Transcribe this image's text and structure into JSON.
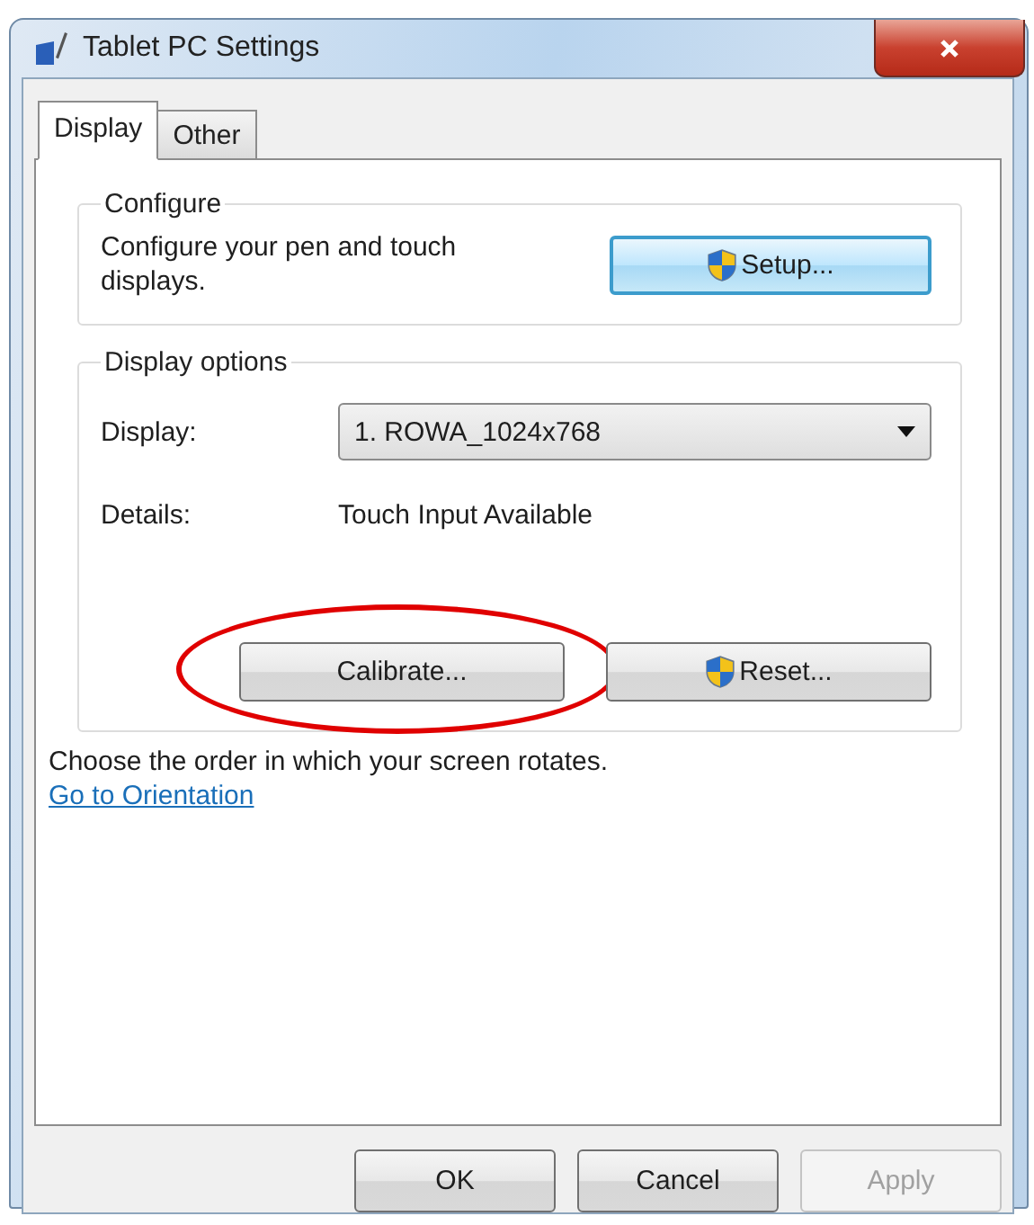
{
  "window": {
    "title": "Tablet PC Settings"
  },
  "tabs": [
    {
      "label": "Display",
      "selected": true
    },
    {
      "label": "Other",
      "selected": false
    }
  ],
  "configure": {
    "legend": "Configure",
    "text": "Configure your pen and touch displays.",
    "button": {
      "label": "Setup...",
      "shield": true,
      "default": true
    }
  },
  "display_options": {
    "legend": "Display options",
    "display_label": "Display:",
    "display_value": "1. ROWA_1024x768",
    "details_label": "Details:",
    "details_value": "Touch Input Available",
    "buttons": [
      {
        "label": "Calibrate...",
        "shield": false,
        "highlighted": true
      },
      {
        "label": "Reset...",
        "shield": true,
        "highlighted": false
      }
    ]
  },
  "orientation": {
    "text": "Choose the order in which your screen rotates.",
    "link": "Go to Orientation"
  },
  "footer_buttons": [
    {
      "label": "OK",
      "disabled": false
    },
    {
      "label": "Cancel",
      "disabled": false
    },
    {
      "label": "Apply",
      "disabled": true
    }
  ]
}
